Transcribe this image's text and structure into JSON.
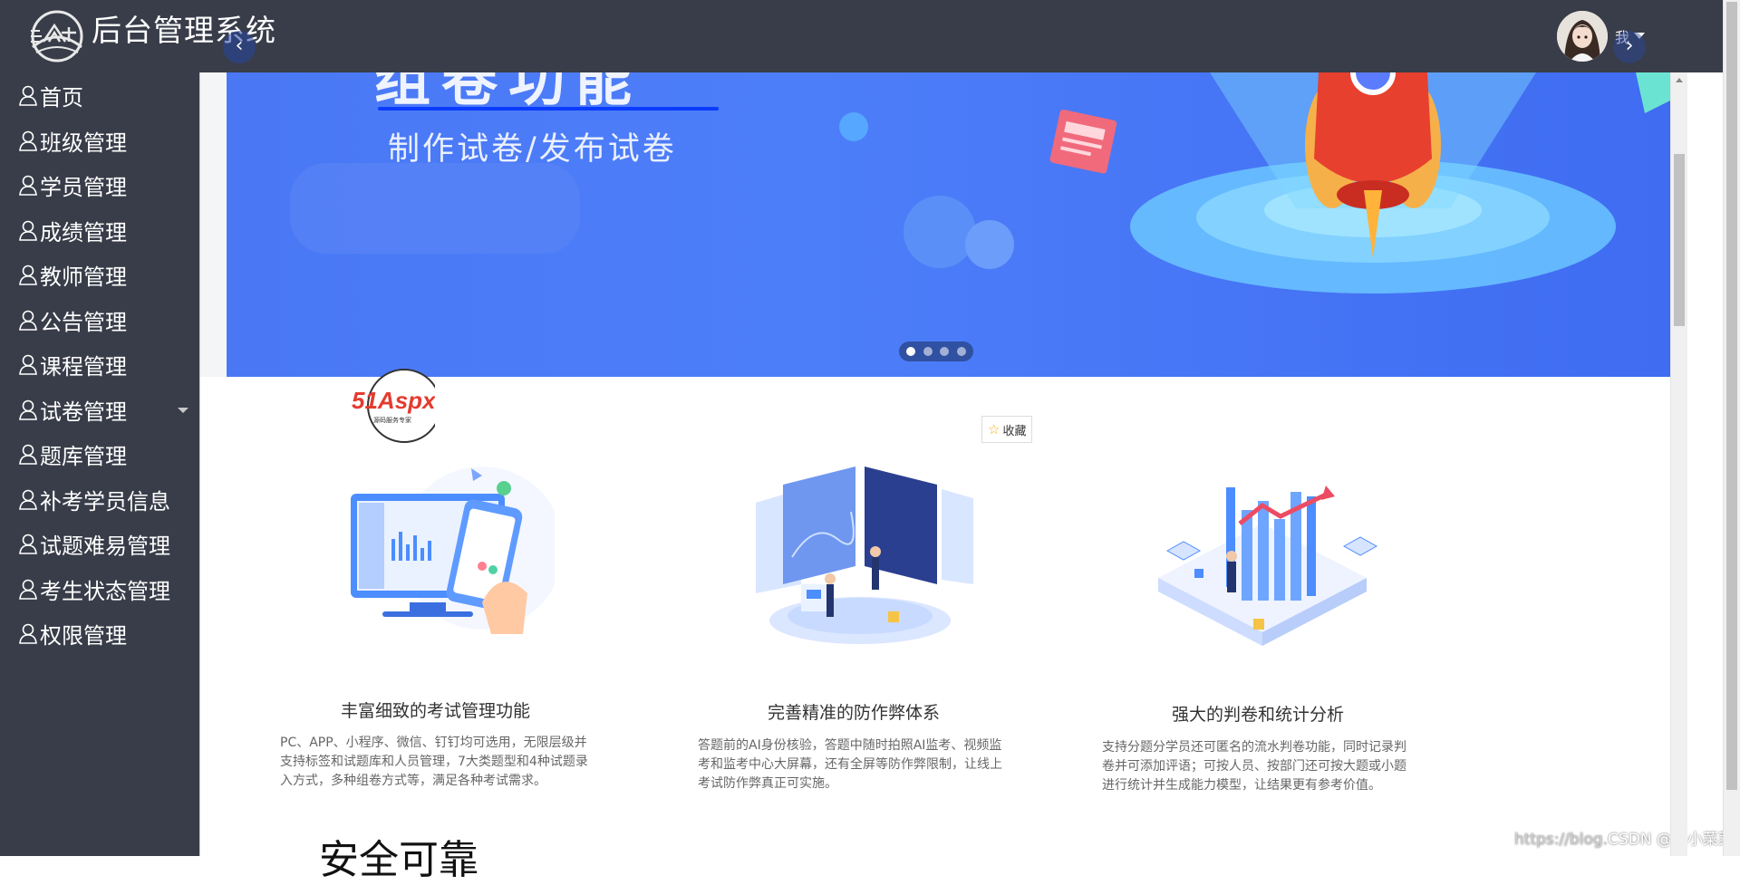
{
  "header": {
    "title": "后台管理系统",
    "user_label": "我"
  },
  "sidebar": {
    "items": [
      {
        "label": "首页"
      },
      {
        "label": "班级管理"
      },
      {
        "label": "学员管理"
      },
      {
        "label": "成绩管理"
      },
      {
        "label": "教师管理"
      },
      {
        "label": "公告管理"
      },
      {
        "label": "课程管理"
      },
      {
        "label": "试卷管理",
        "has_submenu": true
      },
      {
        "label": "题库管理"
      },
      {
        "label": "补考学员信息"
      },
      {
        "label": "试题难易管理"
      },
      {
        "label": "考生状态管理"
      },
      {
        "label": "权限管理"
      }
    ]
  },
  "banner": {
    "headline": "组卷功能",
    "subtitle": "制作试卷/发布试卷",
    "slide_count": 4,
    "active_slide": 1,
    "colors": {
      "bg": "#4a78f5",
      "accent": "#0a3bff"
    }
  },
  "watermark": {
    "logo_text": "51Aspx",
    "logo_sub": "源码服务专家"
  },
  "collect_button": {
    "label": "收藏"
  },
  "features": [
    {
      "title": "丰富细致的考试管理功能",
      "description": "PC、APP、小程序、微信、钉钉均可选用，无限层级并支持标签和试题库和人员管理，7大类题型和4种试题录入方式，多种组卷方式等，满足各种考试需求。"
    },
    {
      "title": "完善精准的防作弊体系",
      "description": "答题前的AI身份核验，答题中随时拍照AI监考、视频监考和监考中心大屏幕，还有全屏等防作弊限制，让线上考试防作弊真正可实施。"
    },
    {
      "title": "强大的判卷和统计分析",
      "description": "支持分题分学员还可匿名的流水判卷功能，同时记录判卷并可添加评语；可按人员、按部门还可按大题或小题进行统计并生成能力模型，让结果更有参考价值。"
    }
  ],
  "section": {
    "title": "安全可靠"
  },
  "credit": {
    "url": "https://blog.",
    "text": "CSDN @张小菜菜"
  }
}
